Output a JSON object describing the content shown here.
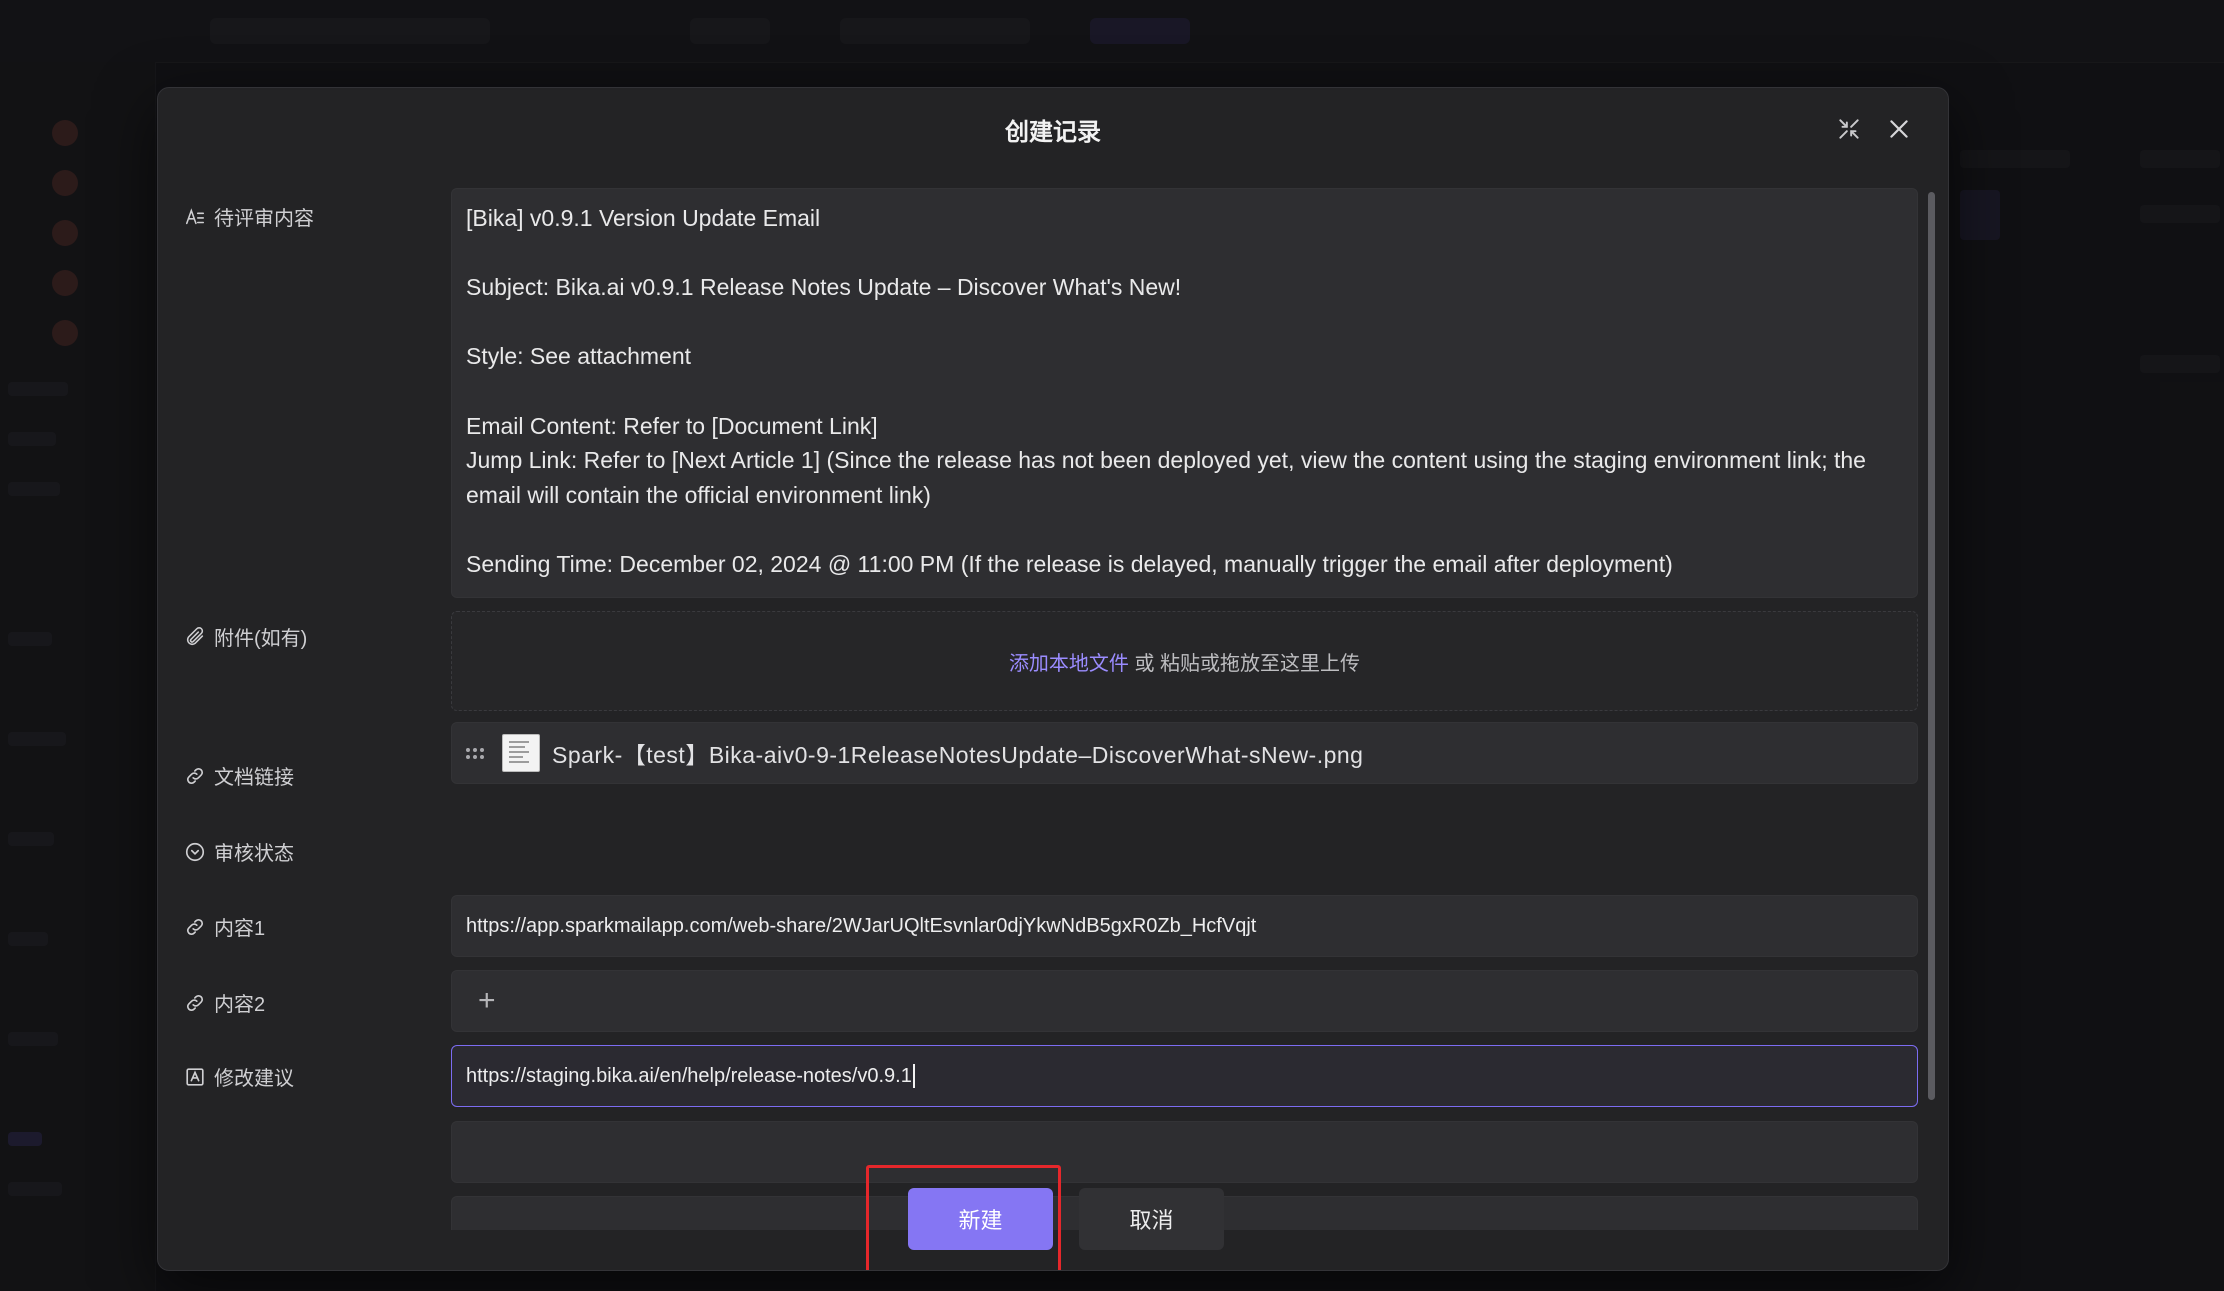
{
  "modal": {
    "title": "创建记录",
    "expand_icon": "collapse-arrows-icon",
    "close_icon": "close-icon"
  },
  "fields": {
    "content": {
      "label": "待评审内容",
      "icon": "text-icon",
      "value": "[Bika] v0.9.1 Version Update Email\n\nSubject: Bika.ai v0.9.1 Release Notes Update – Discover What's New!\n\nStyle: See attachment\n\nEmail Content: Refer to [Document Link]\nJump Link: Refer to [Next Article 1] (Since the release has not been deployed yet, view the content using the staging environment link; the email will contain the official environment link)\n\nSending Time: December 02, 2024 @ 11:00 PM (If the release is delayed, manually trigger the email after deployment)"
    },
    "attachment": {
      "label": "附件(如有)",
      "icon": "paperclip-icon",
      "upload_link": "添加本地文件",
      "upload_hint": " 或 粘贴或拖放至这里上传",
      "file_name": "Spark-【test】Bika-aiv0-9-1ReleaseNotesUpdate–DiscoverWhat-sNew-.png"
    },
    "doc_link": {
      "label": "文档链接",
      "icon": "link-icon",
      "value": "https://app.sparkmailapp.com/web-share/2WJarUQltEsvnlar0djYkwNdB5gxR0Zb_HcfVqjt"
    },
    "review_status": {
      "label": "审核状态",
      "icon": "chevron-circle-icon",
      "add_symbol": "+"
    },
    "content1": {
      "label": "内容1",
      "icon": "link-icon",
      "value": "https://staging.bika.ai/en/help/release-notes/v0.9.1"
    },
    "content2": {
      "label": "内容2",
      "icon": "link-icon",
      "value": ""
    },
    "suggestion": {
      "label": "修改建议",
      "icon": "textarea-icon"
    }
  },
  "footer": {
    "create_label": "新建",
    "cancel_label": "取消"
  },
  "colors": {
    "accent": "#8576f3",
    "highlight": "#e5272b",
    "link": "#9b8cff"
  }
}
